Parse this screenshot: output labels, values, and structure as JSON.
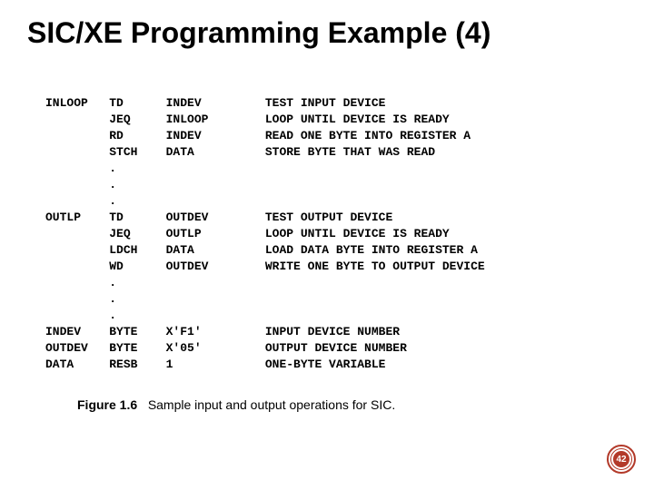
{
  "title": "SIC/XE Programming Example (4)",
  "code_lines": [
    {
      "label": "INLOOP",
      "op": "TD",
      "operand": "INDEV",
      "comment": "TEST INPUT DEVICE"
    },
    {
      "label": "",
      "op": "JEQ",
      "operand": "INLOOP",
      "comment": "LOOP UNTIL DEVICE IS READY"
    },
    {
      "label": "",
      "op": "RD",
      "operand": "INDEV",
      "comment": "READ ONE BYTE INTO REGISTER A"
    },
    {
      "label": "",
      "op": "STCH",
      "operand": "DATA",
      "comment": "STORE BYTE THAT WAS READ"
    },
    {
      "label": "",
      "op": ".",
      "operand": "",
      "comment": ""
    },
    {
      "label": "",
      "op": ".",
      "operand": "",
      "comment": ""
    },
    {
      "label": "",
      "op": ".",
      "operand": "",
      "comment": ""
    },
    {
      "label": "OUTLP",
      "op": "TD",
      "operand": "OUTDEV",
      "comment": "TEST OUTPUT DEVICE"
    },
    {
      "label": "",
      "op": "JEQ",
      "operand": "OUTLP",
      "comment": "LOOP UNTIL DEVICE IS READY"
    },
    {
      "label": "",
      "op": "LDCH",
      "operand": "DATA",
      "comment": "LOAD DATA BYTE INTO REGISTER A"
    },
    {
      "label": "",
      "op": "WD",
      "operand": "OUTDEV",
      "comment": "WRITE ONE BYTE TO OUTPUT DEVICE"
    },
    {
      "label": "",
      "op": ".",
      "operand": "",
      "comment": ""
    },
    {
      "label": "",
      "op": ".",
      "operand": "",
      "comment": ""
    },
    {
      "label": "",
      "op": ".",
      "operand": "",
      "comment": ""
    },
    {
      "label": "INDEV",
      "op": "BYTE",
      "operand": "X'F1'",
      "comment": "INPUT DEVICE NUMBER"
    },
    {
      "label": "OUTDEV",
      "op": "BYTE",
      "operand": "X'05'",
      "comment": "OUTPUT DEVICE NUMBER"
    },
    {
      "label": "DATA",
      "op": "RESB",
      "operand": "1",
      "comment": "ONE-BYTE VARIABLE"
    }
  ],
  "caption_label": "Figure 1.6",
  "caption_text": "Sample input and output operations for SIC.",
  "page_number": "42"
}
